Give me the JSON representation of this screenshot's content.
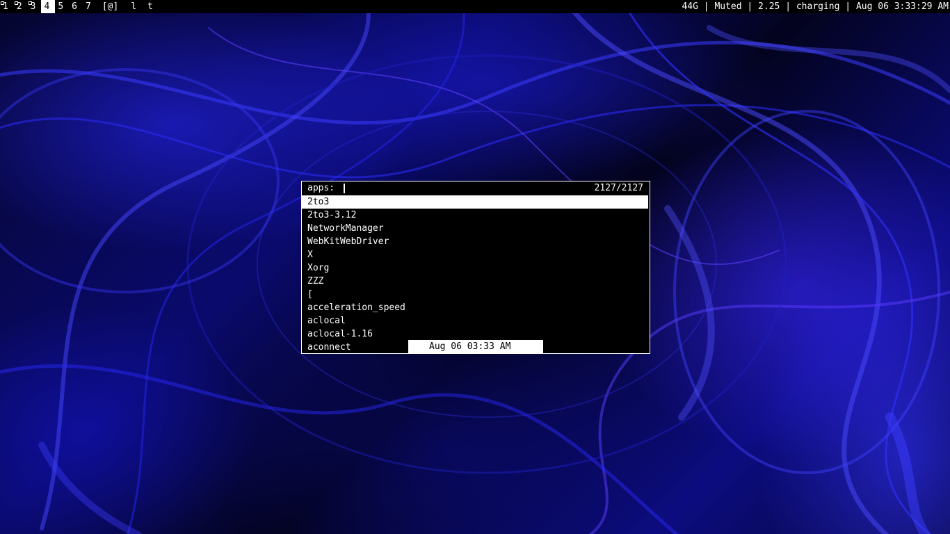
{
  "bar": {
    "tags": [
      {
        "label": "1",
        "occupied": true,
        "active": false
      },
      {
        "label": "2",
        "occupied": true,
        "active": false
      },
      {
        "label": "3",
        "occupied": true,
        "active": false
      },
      {
        "label": "4",
        "occupied": false,
        "active": true
      },
      {
        "label": "5",
        "occupied": false,
        "active": false
      },
      {
        "label": "6",
        "occupied": false,
        "active": false
      },
      {
        "label": "7",
        "occupied": false,
        "active": false
      }
    ],
    "layout_symbol": "[@]",
    "layout_name": "l",
    "window_title": "t",
    "status": "44G | Muted | 2.25 | charging | Aug 06 3:33:29 AM"
  },
  "launcher": {
    "prompt": "apps:",
    "input_value": "",
    "match_count": "2127/2127",
    "items": [
      "2to3",
      "2to3-3.12",
      "NetworkManager",
      "WebKitWebDriver",
      "X",
      "Xorg",
      "ZZZ",
      "[",
      "acceleration_speed",
      "aclocal",
      "aclocal-1.16",
      "aconnect"
    ],
    "selected_index": 0
  },
  "clock_popup": "Aug 06 03:33 AM",
  "colors": {
    "bar_bg": "#000000",
    "fg": "#ffffff",
    "selected_bg": "#ffffff",
    "selected_fg": "#000000"
  }
}
